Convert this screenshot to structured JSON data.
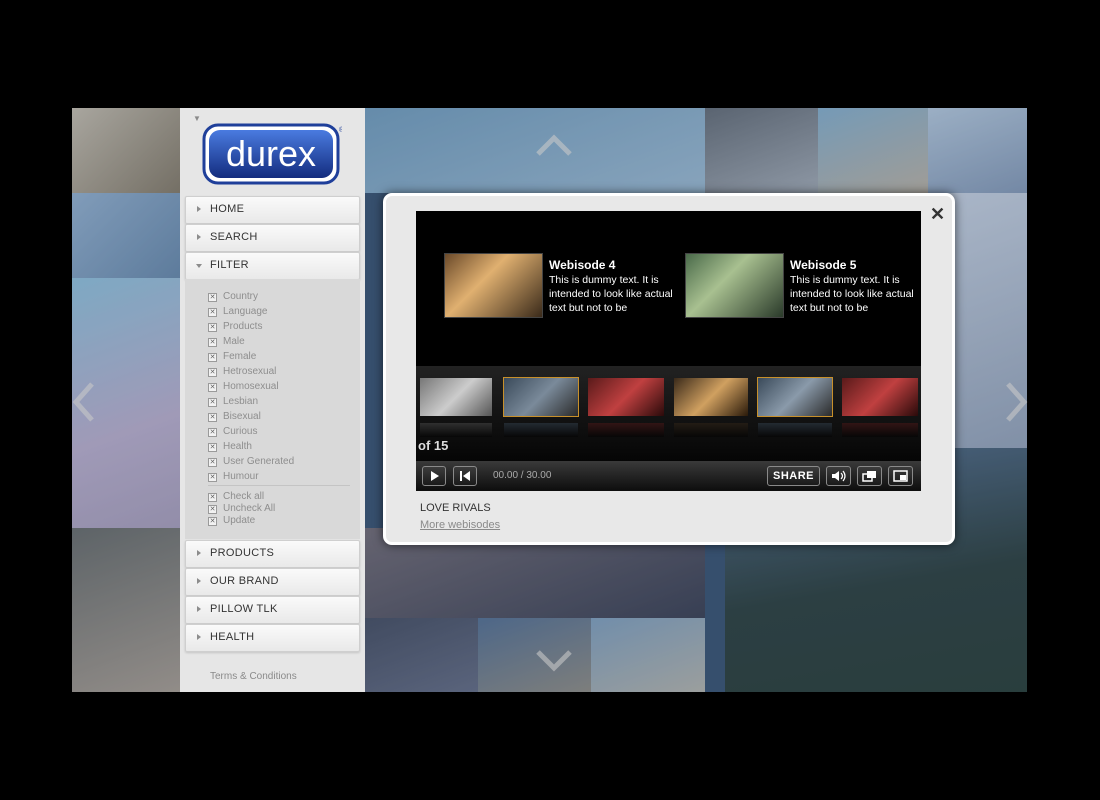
{
  "sidebar": {
    "logo_text": "durex",
    "nav_top": [
      {
        "label": "HOME"
      },
      {
        "label": "SEARCH"
      },
      {
        "label": "FILTER"
      }
    ],
    "filters": [
      "Country",
      "Language",
      "Products",
      "Male",
      "Female",
      "Hetrosexual",
      "Homosexual",
      "Lesbian",
      "Bisexual",
      "Curious",
      "Health",
      "User Generated",
      "Humour"
    ],
    "filter_actions": [
      "Check all",
      "Uncheck All",
      "Update"
    ],
    "nav_bottom": [
      {
        "label": "PRODUCTS"
      },
      {
        "label": "OUR BRAND"
      },
      {
        "label": "PILLOW TLK"
      },
      {
        "label": "HEALTH"
      }
    ],
    "terms": "Terms & Conditions"
  },
  "modal": {
    "close_symbol": "✕",
    "episodes": [
      {
        "title": "Webisode 4",
        "description": "This is dummy text. It is intended to look like actual text but not to be"
      },
      {
        "title": "Webisode 5",
        "description": "This is dummy text. It is intended to look like actual text but not to be"
      }
    ],
    "counter": "of 15",
    "timecode": "00.00 / 30.00",
    "share_label": "SHARE",
    "series_title": "LOVE RIVALS",
    "more_link": "More webisodes"
  },
  "icons": {
    "logo": "durex-logo",
    "up": "chevron-up-icon",
    "down": "chevron-down-icon",
    "left": "chevron-left-icon",
    "right": "chevron-right-icon",
    "play": "play-icon",
    "rewind": "skip-back-icon",
    "volume": "volume-icon",
    "popout": "popout-icon",
    "fullscreen": "fullscreen-icon",
    "close": "close-icon"
  },
  "colors": {
    "brand_blue": "#1f3f9a",
    "accent_gold": "#c8902a",
    "background": "#000000",
    "sidebar": "#e6e6e6"
  }
}
